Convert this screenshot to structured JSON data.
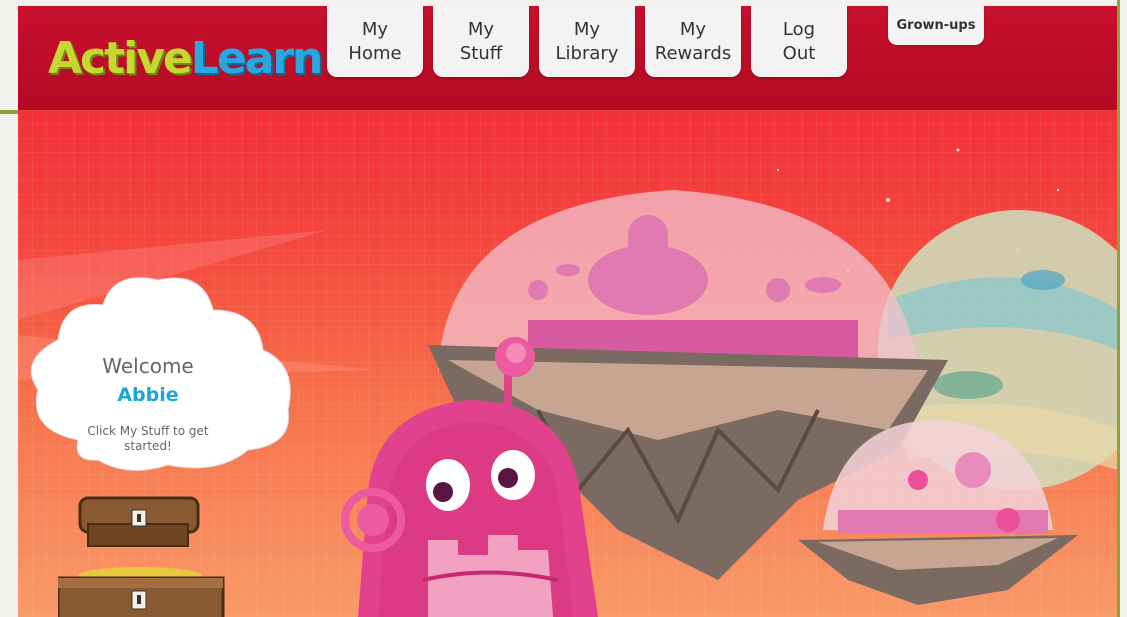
{
  "logo": {
    "part1": "Active",
    "part2": "Learn"
  },
  "nav": {
    "items": [
      {
        "line1": "My",
        "line2": "Home"
      },
      {
        "line1": "My",
        "line2": "Stuff"
      },
      {
        "line1": "My",
        "line2": "Library"
      },
      {
        "line1": "My",
        "line2": "Rewards"
      },
      {
        "line1": "Log",
        "line2": "Out"
      }
    ],
    "grownups": "Grown-ups"
  },
  "welcome": {
    "title": "Welcome",
    "name": "Abbie",
    "message": "Click My Stuff to get started!"
  },
  "colors": {
    "header": "#c8102e",
    "logo_green": "#c6d82f",
    "logo_blue": "#2aa7df",
    "welcome_name": "#1aa6d9",
    "robot_pink": "#e2418d"
  }
}
